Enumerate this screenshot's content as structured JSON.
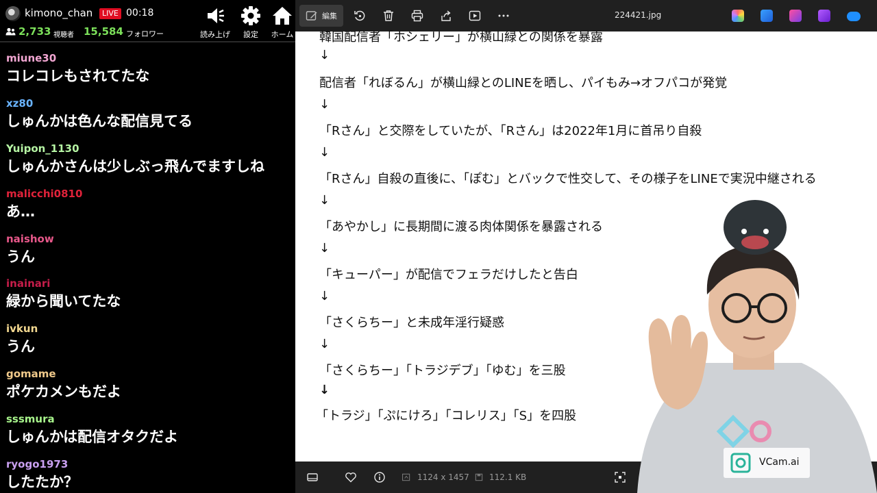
{
  "chat_header": {
    "streamer": "kimono_chan",
    "live_label": "LIVE",
    "elapsed": "00:18",
    "viewers": "2,733",
    "viewers_label": "視聴者",
    "followers": "15,584",
    "followers_label": "フォロワー",
    "buttons": {
      "read_aloud": "読み上げ",
      "settings": "設定",
      "home": "ホーム"
    }
  },
  "chat": {
    "messages": [
      {
        "user": "miune30",
        "text": "コレコレもされてたな",
        "color": "#f2a6d2"
      },
      {
        "user": "xz80",
        "text": "しゅんかは色んな配信見てる",
        "color": "#6ab4ff"
      },
      {
        "user": "Yuipon_1130",
        "text": "しゅんかさんは少しぶっ飛んでますしね",
        "color": "#b6f5a4"
      },
      {
        "user": "malicchi0810",
        "text": "あ…",
        "color": "#e0223a"
      },
      {
        "user": "naishow",
        "text": "うん",
        "color": "#e8588a"
      },
      {
        "user": "inainari",
        "text": "緑から聞いてたな",
        "color": "#c61d4a"
      },
      {
        "user": "ivkun",
        "text": "うん",
        "color": "#f3d890"
      },
      {
        "user": "gomame",
        "text": "ポケカメンもだよ",
        "color": "#f0c98a"
      },
      {
        "user": "sssmura",
        "text": "しゅんかは配信オタクだよ",
        "color": "#a8f58c"
      },
      {
        "user": "ryogo1973",
        "text": "したたか？",
        "color": "#c9a0f0"
      }
    ]
  },
  "viewer": {
    "toolbar": {
      "edit_label": "編集",
      "file_name": "224421.jpg"
    },
    "document": {
      "lines": [
        "韓国配信者「ホシェリー」が横山緑との関係を暴露",
        "配信者「れぼるん」が横山緑とのLINEを晒し、パイもみ→オフパコが発覚",
        "「Rさん」と交際をしていたが、「Rさん」は2022年1月に首吊り自殺",
        "「Rさん」自殺の直後に、「ぽむ」とバックで性交して、その様子をLINEで実況中継される",
        "「あやかし」に長期間に渡る肉体関係を暴露される",
        "「キューパー」が配信でフェラだけしたと告白",
        "「さくらちー」と未成年淫行疑惑",
        "「さくらちー」「トラジデブ」「ゆむ」を三股",
        "「トラジ」「ぷにけろ」「コレリス」「S」を四股"
      ],
      "arrow": "↓"
    },
    "status": {
      "dimensions": "1124 x 1457",
      "file_size": "112.1 KB"
    }
  },
  "overlay": {
    "brand": "VCam.ai"
  },
  "colors": {
    "live_red": "#e00d22",
    "count_green": "#7ce05a",
    "toolbar_bg": "#202020"
  }
}
